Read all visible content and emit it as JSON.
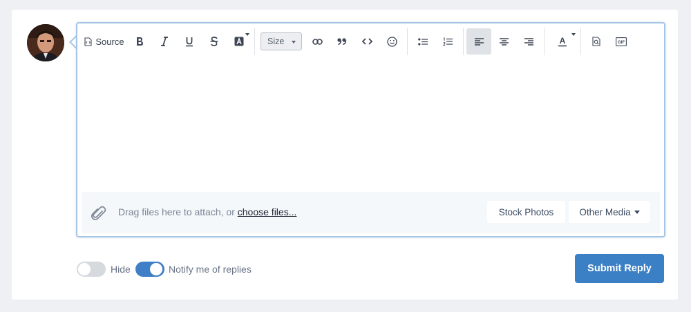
{
  "toolbar": {
    "source_label": "Source",
    "size_label": "Size",
    "gif_label": "GIF",
    "text_color_letter": "A"
  },
  "attachments": {
    "text": "Drag files here to attach, or ",
    "link": "choose files...",
    "stock_photos": "Stock Photos",
    "other_media": "Other Media"
  },
  "options": {
    "hide_label": "Hide",
    "hide_on": false,
    "notify_label": "Notify me of replies",
    "notify_on": true
  },
  "submit_label": "Submit Reply",
  "colors": {
    "accent": "#3b7fc4",
    "editor_border": "#a6c4e3",
    "toggle_off": "#d6d9de"
  }
}
